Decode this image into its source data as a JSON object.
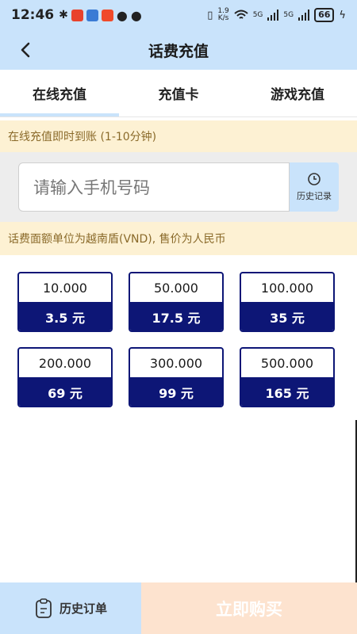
{
  "status_bar": {
    "time": "12:46",
    "network_speed": "1.9\nK/s",
    "signal1": "5G",
    "signal2": "5G",
    "battery": "66"
  },
  "header": {
    "title": "话费充值"
  },
  "tabs": [
    {
      "label": "在线充值",
      "active": true
    },
    {
      "label": "充值卡",
      "active": false
    },
    {
      "label": "游戏充值",
      "active": false
    }
  ],
  "notice_top": "在线充值即时到账 (1-10分钟)",
  "phone": {
    "placeholder": "请输入手机号码",
    "history_label": "历史记录"
  },
  "notice_unit": "话费面额单位为越南盾(VND), 售价为人民币",
  "denominations": [
    {
      "face": "10.000",
      "price": "3.5 元"
    },
    {
      "face": "50.000",
      "price": "17.5 元"
    },
    {
      "face": "100.000",
      "price": "35 元"
    },
    {
      "face": "200.000",
      "price": "69 元"
    },
    {
      "face": "300.000",
      "price": "99 元"
    },
    {
      "face": "500.000",
      "price": "165 元"
    }
  ],
  "bottom": {
    "orders_label": "历史订单",
    "buy_label": "立即购买"
  },
  "colors": {
    "header_bg": "#c9e3fb",
    "card_navy": "#0d1676",
    "notice_bg": "#fdf1d3",
    "buy_bg": "#fde3cf"
  }
}
